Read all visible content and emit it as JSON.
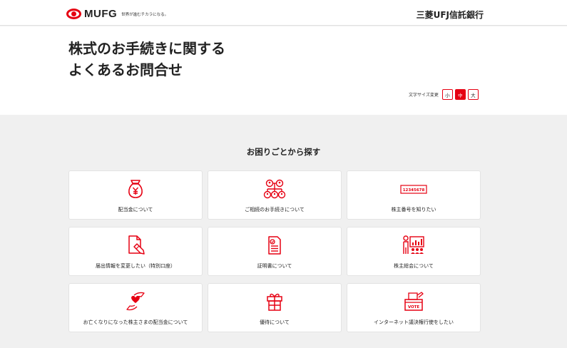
{
  "header": {
    "logo_text": "MUFG",
    "logo_tagline": "世界が進むチカラになる。",
    "bank_name": "三菱UFJ信託銀行"
  },
  "hero": {
    "title_line1": "株式のお手続きに関する",
    "title_line2": "よくあるお問合せ",
    "font_size_label": "文字サイズ変更",
    "font_sizes": [
      "小",
      "中",
      "大"
    ],
    "font_size_selected": "中"
  },
  "main": {
    "section_title": "お困りごとから探す",
    "cards": [
      {
        "label": "配当金について",
        "icon": "money-bag-icon"
      },
      {
        "label": "ご相続のお手続きについて",
        "icon": "family-tree-icon"
      },
      {
        "label": "株主番号を知りたい",
        "icon": "number-card-icon"
      },
      {
        "label": "届出情報を変更したい（特別口座）",
        "icon": "document-pen-icon"
      },
      {
        "label": "証明書について",
        "icon": "certificate-icon"
      },
      {
        "label": "株主総会について",
        "icon": "meeting-presentation-icon"
      },
      {
        "label": "お亡くなりになった株主さまの配当金について",
        "icon": "hands-heart-icon"
      },
      {
        "label": "優待について",
        "icon": "gift-icon"
      },
      {
        "label": "インターネット議決権行使をしたい",
        "icon": "vote-box-icon"
      }
    ],
    "number_card_text": "12345678",
    "vote_text": "VOTE"
  },
  "colors": {
    "accent": "#e60012",
    "background": "#f0f0f0",
    "card": "#ffffff"
  }
}
